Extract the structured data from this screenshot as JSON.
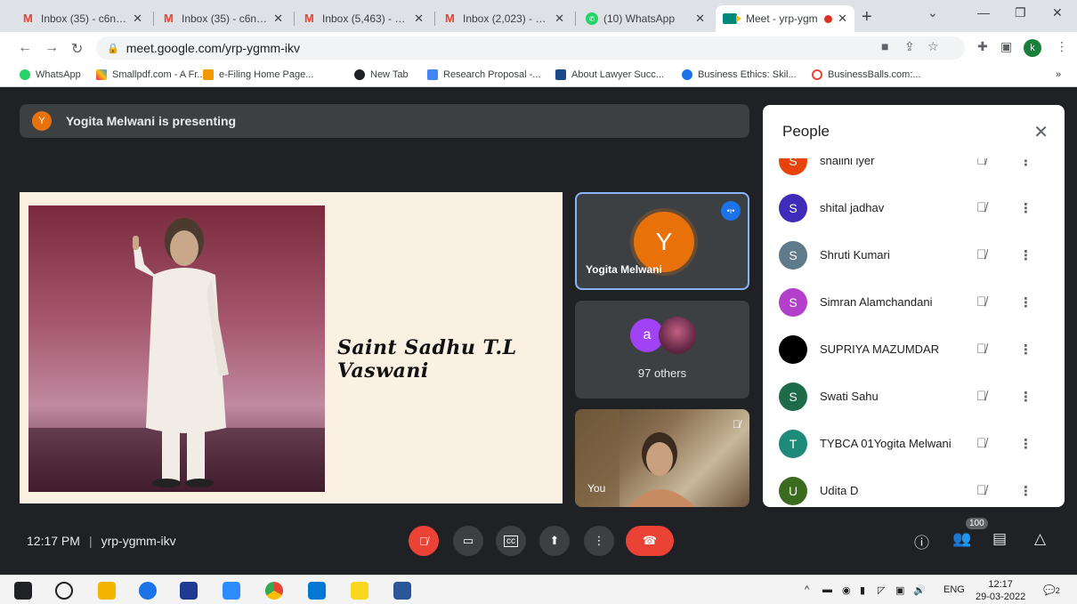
{
  "browser": {
    "tabs": [
      {
        "title": "Inbox (35) - c6naac",
        "icon": "gmail-icon"
      },
      {
        "title": "Inbox (35) - c6naac",
        "icon": "gmail-icon"
      },
      {
        "title": "Inbox (5,463) - kaja",
        "icon": "gmail-icon"
      },
      {
        "title": "Inbox (2,023) - kaja",
        "icon": "gmail-icon"
      },
      {
        "title": "(10) WhatsApp",
        "icon": "whatsapp-icon"
      },
      {
        "title": "Meet - yrp-ygm",
        "icon": "meet-icon"
      }
    ],
    "url": "meet.google.com/yrp-ygmm-ikv",
    "profile_initial": "k",
    "bookmarks": [
      {
        "label": "WhatsApp",
        "color": "#25d366"
      },
      {
        "label": "Smallpdf.com - A Fr...",
        "color": "#e91e63"
      },
      {
        "label": "e-Filing Home Page...",
        "color": "#f29900"
      },
      {
        "label": "New Tab",
        "color": "#202124"
      },
      {
        "label": "Research Proposal -...",
        "color": "#4285f4"
      },
      {
        "label": "About Lawyer Succ...",
        "color": "#1a4a8a"
      },
      {
        "label": "Business Ethics: Skil...",
        "color": "#1a73e8"
      },
      {
        "label": "BusinessBalls.com:...",
        "color": "#ea4335"
      }
    ]
  },
  "meet": {
    "banner": {
      "initial": "Y",
      "text": "Yogita Melwani is presenting"
    },
    "slide_caption": "Saint Sadhu T.L Vaswani",
    "speaker": {
      "initial": "Y",
      "name": "Yogita Melwani"
    },
    "others": {
      "initial": "a",
      "label": "97 others"
    },
    "self_label": "You",
    "people_title": "People",
    "participants": [
      {
        "initial": "S",
        "name": "shalini iyer",
        "color": "#e8430a"
      },
      {
        "initial": "S",
        "name": "shital jadhav",
        "color": "#3f2cb8"
      },
      {
        "initial": "S",
        "name": "Shruti Kumari",
        "color": "#5f7a8a"
      },
      {
        "initial": "S",
        "name": "Simran Alamchandani",
        "color": "#b33fcb"
      },
      {
        "initial": "",
        "name": "SUPRIYA MAZUMDAR",
        "color": "#000000"
      },
      {
        "initial": "S",
        "name": "Swati Sahu",
        "color": "#1e6b4a"
      },
      {
        "initial": "T",
        "name": "TYBCA 01Yogita Melwani",
        "color": "#1e8a7a"
      },
      {
        "initial": "U",
        "name": "Udita D",
        "color": "#3a6b1e"
      }
    ],
    "time": "12:17 PM",
    "meeting_code": "yrp-ygmm-ikv",
    "participant_count": "100"
  },
  "taskbar": {
    "lang": "ENG",
    "time": "12:17",
    "date": "29-03-2022",
    "notif_count": "2"
  }
}
